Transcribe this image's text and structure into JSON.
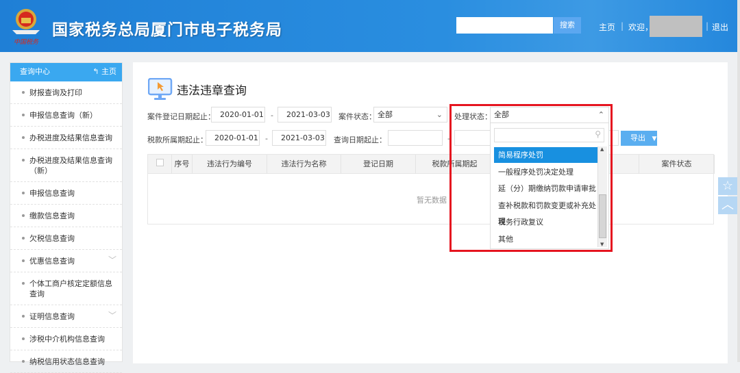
{
  "header": {
    "site_title": "国家税务总局厦门市电子税务局",
    "emblem_text": "中国税务",
    "search_button": "搜索",
    "search_value": "",
    "home_link": "主页",
    "separator": "|",
    "welcome": "欢迎，",
    "logout": "退出"
  },
  "sidebar": {
    "title": "查询中心",
    "home": "主页",
    "items": [
      {
        "label": "财报查询及打印"
      },
      {
        "label": "申报信息查询（新）"
      },
      {
        "label": "办税进度及结果信息查询"
      },
      {
        "label": "办税进度及结果信息查询（新）"
      },
      {
        "label": "申报信息查询"
      },
      {
        "label": "缴款信息查询"
      },
      {
        "label": "欠税信息查询"
      },
      {
        "label": "优惠信息查询",
        "expandable": true
      },
      {
        "label": "个体工商户核定定额信息查询"
      },
      {
        "label": "证明信息查询",
        "expandable": true
      },
      {
        "label": "涉税中介机构信息查询"
      },
      {
        "label": "纳税信用状态信息查询"
      }
    ]
  },
  "page": {
    "title": "违法违章查询"
  },
  "filters": {
    "case_reg_date_label": "案件登记日期起止：",
    "case_reg_from": "2020-01-01",
    "case_reg_to": "2021-03-03",
    "case_status_label": "案件状态：",
    "case_status_value": "全部",
    "tax_period_label": "税款所属期起止：",
    "tax_period_from": "2020-01-01",
    "tax_period_to": "2021-03-03",
    "query_date_label": "查询日期起止：",
    "query_from": "",
    "query_to": "",
    "dash": "-",
    "handle_status_label": "处理状态：",
    "handle_status_value": "全部",
    "export": "导出"
  },
  "dropdown": {
    "search_value": "",
    "options": [
      "简易程序处罚",
      "一般程序处罚决定处理",
      "延（分）期缴纳罚款申请审批",
      "查补税款和罚款变更或补充处理",
      "税务行政复议",
      "其他"
    ],
    "highlighted": 0
  },
  "table": {
    "columns": [
      "序号",
      "违法行为编号",
      "违法行为名称",
      "登记日期",
      "税款所属期起",
      "",
      "",
      "案件状态"
    ],
    "empty_text": "暂无数据"
  },
  "colors": {
    "header_blue": "#2487dc",
    "accent": "#3aa8f0",
    "highlight": "#1890e0",
    "annotation": "#e5141f"
  }
}
